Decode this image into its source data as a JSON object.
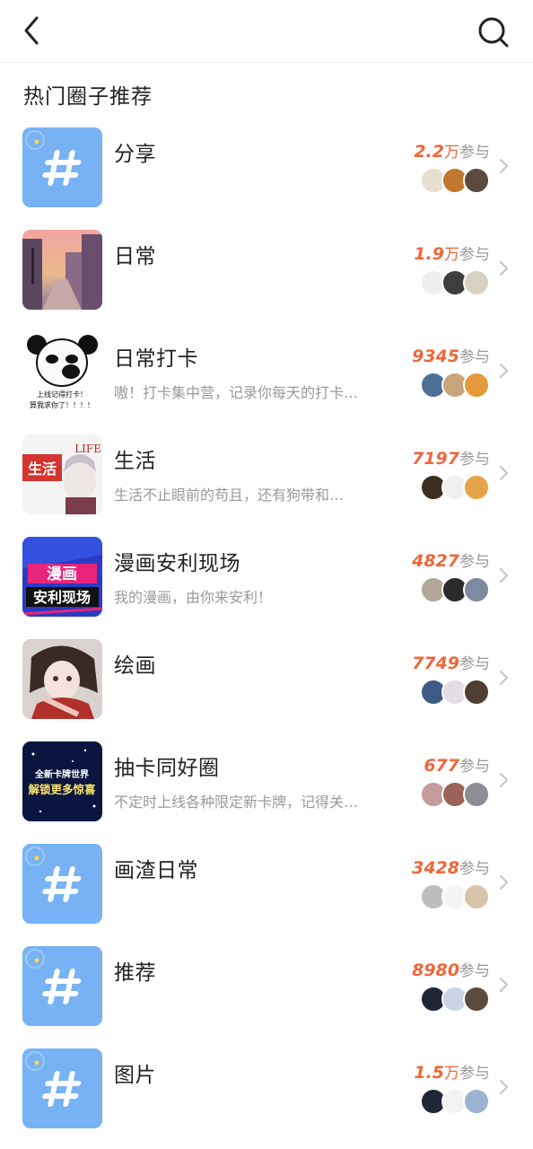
{
  "header": {
    "back_icon": "chevron-left-icon",
    "search_icon": "search-icon"
  },
  "section": {
    "title": "热门圈子推荐"
  },
  "circles": [
    {
      "name": "分享",
      "desc": "",
      "num": "2.2",
      "unit": "万",
      "label": "参与",
      "thumb": "hash",
      "avatars": [
        "#5a4a40",
        "#c2782e",
        "#e6dfd0"
      ]
    },
    {
      "name": "日常",
      "desc": "",
      "num": "1.9",
      "unit": "万",
      "label": "参与",
      "thumb": "street",
      "avatars": [
        "#d9d2c4",
        "#3e3e3e",
        "#efefef"
      ]
    },
    {
      "name": "日常打卡",
      "desc": "嗷！打卡集中营，记录你每天的打卡…",
      "num": "9345",
      "unit": "",
      "label": "参与",
      "thumb": "panda",
      "thumb_text": [
        "上线记得打卡！",
        "算我求你了！！！！"
      ],
      "avatars": [
        "#e39a3a",
        "#c9a47a",
        "#4e6f96"
      ]
    },
    {
      "name": "生活",
      "desc": "生活不止眼前的苟且，还有狗带和…",
      "num": "7197",
      "unit": "",
      "label": "参与",
      "thumb": "life",
      "thumb_text": [
        "生活",
        "LIFE"
      ],
      "avatars": [
        "#e5a449",
        "#f0f0f0",
        "#3b2e22"
      ]
    },
    {
      "name": "漫画安利现场",
      "desc": "我的漫画，由你来安利！",
      "num": "4827",
      "unit": "",
      "label": "参与",
      "thumb": "comic",
      "thumb_text": [
        "漫画",
        "安利现场"
      ],
      "avatars": [
        "#7d8aa0",
        "#2b2b2b",
        "#b3a79a"
      ]
    },
    {
      "name": "绘画",
      "desc": "",
      "num": "7749",
      "unit": "",
      "label": "参与",
      "thumb": "drawing",
      "avatars": [
        "#4f3d33",
        "#e3dde8",
        "#3d5a88"
      ]
    },
    {
      "name": "抽卡同好圈",
      "desc": "不定时上线各种限定新卡牌，记得关…",
      "num": "677",
      "unit": "",
      "label": "参与",
      "thumb": "cards",
      "thumb_text": [
        "全新卡牌世界",
        "解锁更多惊喜"
      ],
      "avatars": [
        "#8d8d95",
        "#9a6258",
        "#c49a9a"
      ]
    },
    {
      "name": "画渣日常",
      "desc": "",
      "num": "3428",
      "unit": "",
      "label": "参与",
      "thumb": "hash",
      "avatars": [
        "#d8c4a8",
        "#f4f4f4",
        "#bdbdbd"
      ]
    },
    {
      "name": "推荐",
      "desc": "",
      "num": "8980",
      "unit": "",
      "label": "参与",
      "thumb": "hash",
      "avatars": [
        "#5c4a3e",
        "#c9d3e3",
        "#1e2638"
      ]
    },
    {
      "name": "图片",
      "desc": "",
      "num": "1.5",
      "unit": "万",
      "label": "参与",
      "thumb": "hash",
      "avatars": [
        "#9ab3d1",
        "#f2f2f2",
        "#1e2638"
      ]
    }
  ],
  "colors": {
    "accent": "#f0663a",
    "hash_tile": "#6aa8f2",
    "muted": "#9a9a9a"
  },
  "icons": {
    "row_arrow": "chevron-right-icon",
    "hash_tile": "hashtag-icon"
  }
}
